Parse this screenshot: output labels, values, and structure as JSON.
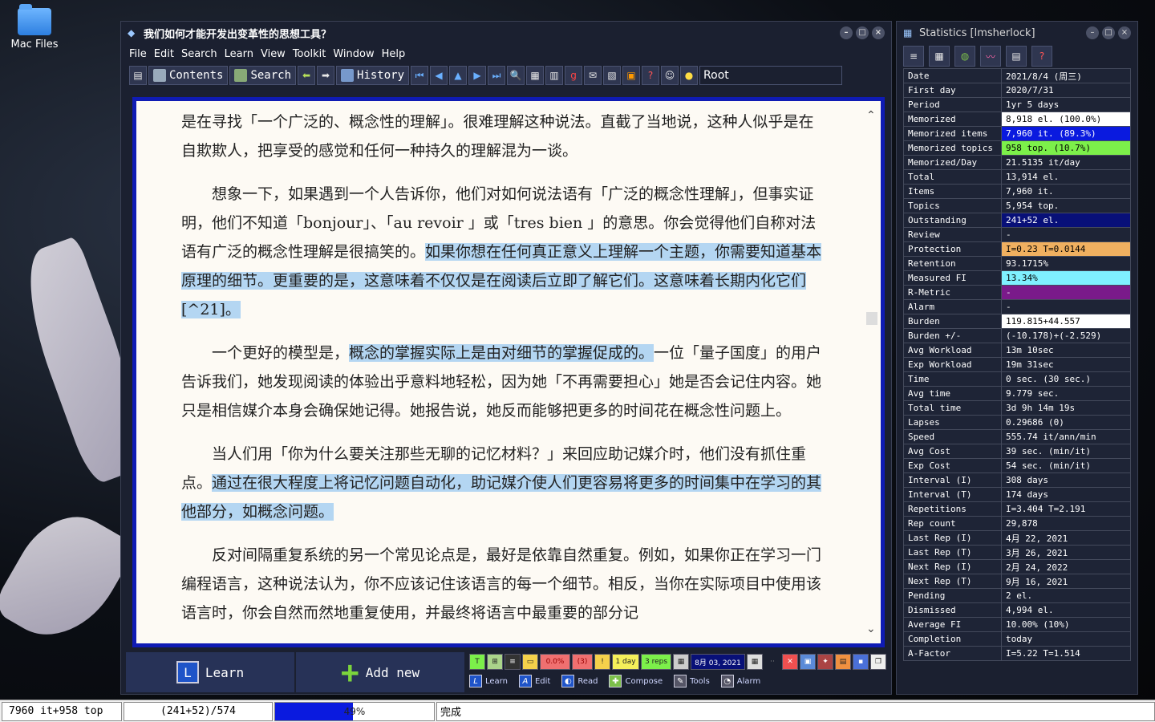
{
  "desktop": {
    "icon_label": "Mac Files"
  },
  "main_window": {
    "title": "我们如何才能开发出变革性的思想工具？",
    "menu": [
      "File",
      "Edit",
      "Search",
      "Learn",
      "View",
      "Toolkit",
      "Window",
      "Help"
    ],
    "toolbar": {
      "contents": "Contents",
      "search": "Search",
      "history": "History",
      "root": "Root"
    },
    "paragraphs": [
      {
        "segments": [
          {
            "text": "是在寻找「一个广泛的、概念性的理解」。很难理解这种说法。直截了当地说，这种人似乎是在自欺欺人，把享受的感觉和任何一种持久的理解混为一谈。",
            "hl": false
          }
        ],
        "first": true
      },
      {
        "segments": [
          {
            "text": "想象一下，如果遇到一个人告诉你，他们对如何说法语有「广泛的概念性理解」，但事实证明，他们不知道「bonjour」、「au revoir 」或「tres bien 」的意思。你会觉得他们自称对法语有广泛的概念性理解是很搞笑的。",
            "hl": false
          },
          {
            "text": "如果你想在任何真正意义上理解一个主题，你需要知道基本原理的细节。更重要的是，这意味着不仅仅是在阅读后立即了解它们。这意味着长期内化它们[^21]。",
            "hl": true
          }
        ]
      },
      {
        "segments": [
          {
            "text": "一个更好的模型是，",
            "hl": false
          },
          {
            "text": "概念的掌握实际上是由对细节的掌握促成的。",
            "hl": true
          },
          {
            "text": "一位「量子国度」的用户告诉我们，她发现阅读的体验出乎意料地轻松，因为她「不再需要担心」她是否会记住内容。她只是相信媒介本身会确保她记得。她报告说，她反而能够把更多的时间花在概念性问题上。",
            "hl": false
          }
        ]
      },
      {
        "segments": [
          {
            "text": "当人们用「你为什么要关注那些无聊的记忆材料？」来回应助记媒介时，他们没有抓住重点。",
            "hl": false
          },
          {
            "text": "通过在很大程度上将记忆问题自动化，助记媒介使人们更容易将更多的时间集中在学习的其他部分，如概念问题。",
            "hl": true
          }
        ]
      },
      {
        "segments": [
          {
            "text": "反对间隔重复系统的另一个常见论点是，最好是依靠自然重复。例如，如果你正在学习一门编程语言，这种说法认为，你不应该记住该语言的每一个细节。相反，当你在实际项目中使用该语言时，你会自然而然地重复使用，并最终将语言中最重要的部分记",
            "hl": false
          }
        ]
      }
    ],
    "bottom": {
      "learn": "Learn",
      "add_new": "Add new"
    },
    "mini": {
      "pct": "0.0%",
      "count": "(3)",
      "day": "1 day",
      "reps": "3 reps",
      "date": "8月 03, 2021"
    },
    "nav2": [
      "Learn",
      "Edit",
      "Read",
      "Compose",
      "Tools",
      "Alarm"
    ]
  },
  "stats_window": {
    "title": "Statistics [lmsherlock]",
    "rows": [
      {
        "k": "Date",
        "v": "2021/8/4 (周三)",
        "bg": ""
      },
      {
        "k": "First day",
        "v": "2020/7/31",
        "bg": ""
      },
      {
        "k": "Period",
        "v": "1yr 5 days",
        "bg": ""
      },
      {
        "k": "Memorized",
        "v": "8,918 el. (100.0%)",
        "bg": "#ffffff",
        "fg": "#000000"
      },
      {
        "k": "Memorized items",
        "v": "7,960 it. (89.3%)",
        "bg": "#0a1adf",
        "fg": "#ffffff"
      },
      {
        "k": "Memorized topics",
        "v": "958 top. (10.7%)",
        "bg": "#7cf04a",
        "fg": "#000000"
      },
      {
        "k": "Memorized/Day",
        "v": "21.5135 it/day",
        "bg": ""
      },
      {
        "k": "Total",
        "v": "13,914 el.",
        "bg": ""
      },
      {
        "k": "Items",
        "v": "7,960 it.",
        "bg": ""
      },
      {
        "k": "Topics",
        "v": "5,954 top.",
        "bg": ""
      },
      {
        "k": "Outstanding",
        "v": "241+52 el.",
        "bg": "#081078",
        "fg": "#ffffff"
      },
      {
        "k": "Review",
        "v": "-",
        "bg": ""
      },
      {
        "k": "Protection",
        "v": "I=0.23 T=0.0144",
        "bg": "#f0b060",
        "fg": "#000000"
      },
      {
        "k": "Retention",
        "v": "93.1715%",
        "bg": ""
      },
      {
        "k": "Measured FI",
        "v": "13.34%",
        "bg": "#7ff0ff",
        "fg": "#000000"
      },
      {
        "k": "R-Metric",
        "v": "-",
        "bg": "#7a1a8a",
        "fg": "#ffffff"
      },
      {
        "k": "Alarm",
        "v": "-",
        "bg": ""
      },
      {
        "k": "Burden",
        "v": "119.815+44.557",
        "bg": "#ffffff",
        "fg": "#000000"
      },
      {
        "k": "Burden +/-",
        "v": "(-10.178)+(-2.529)",
        "bg": ""
      },
      {
        "k": "Avg Workload",
        "v": "13m 10sec",
        "bg": ""
      },
      {
        "k": "Exp Workload",
        "v": "19m 31sec",
        "bg": ""
      },
      {
        "k": "Time",
        "v": "0 sec. (30 sec.)",
        "bg": ""
      },
      {
        "k": "Avg time",
        "v": "9.779 sec.",
        "bg": ""
      },
      {
        "k": "Total time",
        "v": "3d 9h 14m 19s",
        "bg": ""
      },
      {
        "k": "Lapses",
        "v": "0.29686 (0)",
        "bg": ""
      },
      {
        "k": "Speed",
        "v": "555.74 it/ann/min",
        "bg": ""
      },
      {
        "k": "Avg Cost",
        "v": "39 sec. (min/it)",
        "bg": ""
      },
      {
        "k": "Exp Cost",
        "v": "54 sec. (min/it)",
        "bg": ""
      },
      {
        "k": "Interval (I)",
        "v": "308 days",
        "bg": ""
      },
      {
        "k": "Interval (T)",
        "v": "174 days",
        "bg": ""
      },
      {
        "k": "Repetitions",
        "v": "I=3.404 T=2.191",
        "bg": ""
      },
      {
        "k": "Rep count",
        "v": "29,878",
        "bg": ""
      },
      {
        "k": "Last Rep (I)",
        "v": "4月 22, 2021",
        "bg": ""
      },
      {
        "k": "Last Rep (T)",
        "v": "3月 26, 2021",
        "bg": ""
      },
      {
        "k": "Next Rep (I)",
        "v": "2月 24, 2022",
        "bg": ""
      },
      {
        "k": "Next Rep (T)",
        "v": "9月 16, 2021",
        "bg": ""
      },
      {
        "k": "Pending",
        "v": "2 el.",
        "bg": ""
      },
      {
        "k": "Dismissed",
        "v": "4,994 el.",
        "bg": ""
      },
      {
        "k": "Average FI",
        "v": "10.00% (10%)",
        "bg": ""
      },
      {
        "k": "Completion",
        "v": "today",
        "bg": ""
      },
      {
        "k": "A-Factor",
        "v": "I=5.22 T=1.514",
        "bg": ""
      }
    ]
  },
  "statusbar": {
    "items": "7960 it+958 top",
    "outstanding": "(241+52)/574",
    "progress_label": "49%",
    "progress_value": 0.49,
    "status_text": "完成"
  }
}
